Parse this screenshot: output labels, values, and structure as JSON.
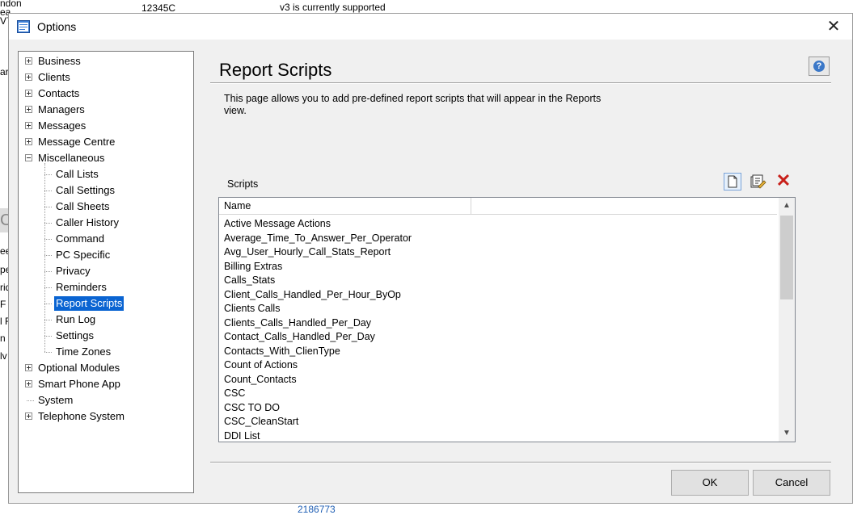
{
  "background": {
    "fragments": [
      "ndon",
      "ea",
      "V7",
      "ar",
      "12345C",
      "v3 is currently supported",
      "ee",
      "pe",
      "rid",
      "F",
      "l F",
      "n",
      "lv",
      "C",
      "2186773"
    ]
  },
  "window": {
    "title": "Options",
    "close_glyph": "✕"
  },
  "tree": {
    "items": [
      {
        "label": "Business",
        "level": 0,
        "expander": "plus"
      },
      {
        "label": "Clients",
        "level": 0,
        "expander": "plus"
      },
      {
        "label": "Contacts",
        "level": 0,
        "expander": "plus"
      },
      {
        "label": "Managers",
        "level": 0,
        "expander": "plus"
      },
      {
        "label": "Messages",
        "level": 0,
        "expander": "plus"
      },
      {
        "label": "Message Centre",
        "level": 0,
        "expander": "plus"
      },
      {
        "label": "Miscellaneous",
        "level": 0,
        "expander": "minus"
      },
      {
        "label": "Call Lists",
        "level": 1
      },
      {
        "label": "Call Settings",
        "level": 1
      },
      {
        "label": "Call Sheets",
        "level": 1
      },
      {
        "label": "Caller History",
        "level": 1
      },
      {
        "label": "Command",
        "level": 1
      },
      {
        "label": "PC Specific",
        "level": 1
      },
      {
        "label": "Privacy",
        "level": 1
      },
      {
        "label": "Reminders",
        "level": 1
      },
      {
        "label": "Report Scripts",
        "level": 1,
        "selected": true
      },
      {
        "label": "Run Log",
        "level": 1
      },
      {
        "label": "Settings",
        "level": 1
      },
      {
        "label": "Time Zones",
        "level": 1
      },
      {
        "label": "Optional Modules",
        "level": 0,
        "expander": "plus"
      },
      {
        "label": "Smart Phone App",
        "level": 0,
        "expander": "plus"
      },
      {
        "label": "System",
        "level": 0
      },
      {
        "label": "Telephone System",
        "level": 0,
        "expander": "plus"
      }
    ]
  },
  "panel": {
    "title": "Report Scripts",
    "description": "This page allows you to add pre-defined report scripts that will appear in the Reports view.",
    "help_glyph": "?",
    "scripts_label": "Scripts",
    "delete_glyph": "✕",
    "icons": {
      "new": "new-document-icon",
      "edit": "edit-document-icon",
      "delete": "delete-icon",
      "help": "help-icon"
    }
  },
  "list": {
    "columns": [
      "Name",
      ""
    ],
    "rows": [
      "Active Message Actions",
      "Average_Time_To_Answer_Per_Operator",
      "Avg_User_Hourly_Call_Stats_Report",
      "Billing Extras",
      "Calls_Stats",
      "Client_Calls_Handled_Per_Hour_ByOp",
      "Clients Calls",
      "Clients_Calls_Handled_Per_Day",
      "Contact_Calls_Handled_Per_Day",
      "Contacts_With_ClienType",
      "Count of Actions",
      "Count_Contacts",
      "CSC",
      "CSC TO DO",
      "CSC_CleanStart",
      "DDI List"
    ],
    "scroll_up_glyph": "▲",
    "scroll_down_glyph": "▼"
  },
  "buttons": {
    "ok": "OK",
    "cancel": "Cancel"
  },
  "colors": {
    "selection": "#0a64d2",
    "delete": "#c8201a",
    "dialog_bg": "#f0f0f0"
  }
}
